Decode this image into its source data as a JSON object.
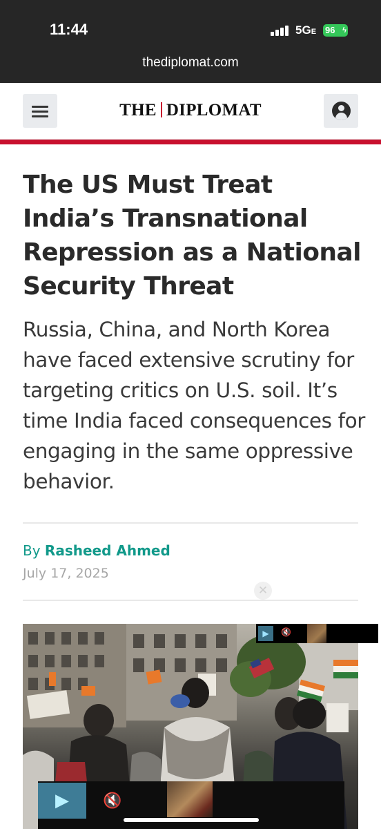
{
  "status_bar": {
    "time": "11:44",
    "network": "5G",
    "network_suffix": "E",
    "battery": "96",
    "battery_color": "#34c759"
  },
  "browser": {
    "url": "thediplomat.com"
  },
  "site_header": {
    "logo_left": "THE",
    "logo_right": "DIPLOMAT",
    "menu_icon": "hamburger-icon",
    "account_icon": "user-circle-icon",
    "accent_color": "#c8102e"
  },
  "article": {
    "headline": "The US Must Treat India’s Transnational Repression as a National Security Threat",
    "dek": "Russia, China, and North Korea have faced extensive scrutiny for targeting critics on U.S. soil. It’s time India faced consequences for engaging in the same oppressive behavior.",
    "byline_prefix": "By",
    "author": "Rasheed Ahmed",
    "date": "July 17, 2025",
    "byline_color": "#11998a"
  },
  "ad": {
    "close_glyph": "✕",
    "mute_glyph": "🔇",
    "logo_glyph": "▶"
  }
}
